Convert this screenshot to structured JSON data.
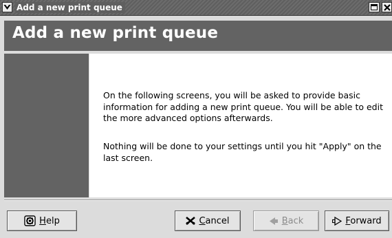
{
  "window": {
    "title": "Add a new print queue",
    "icons": {
      "menu": "chevron-down-icon",
      "maximize": "maximize-icon",
      "close": "close-icon"
    }
  },
  "header": {
    "title": "Add a new print queue"
  },
  "content": {
    "paragraph1": "On the following screens, you will be asked to provide basic information for adding a new print queue.  You will be able to edit the more advanced options afterwards.",
    "paragraph2": "Nothing will be done to your settings until you hit \"Apply\" on the last screen."
  },
  "buttons": {
    "help": {
      "mnemonic": "H",
      "rest": "elp",
      "icon": "help-icon"
    },
    "cancel": {
      "mnemonic": "C",
      "rest": "ancel",
      "icon": "cancel-icon"
    },
    "back": {
      "mnemonic": "B",
      "rest": "ack",
      "icon": "back-arrow-icon",
      "enabled": false
    },
    "forward": {
      "mnemonic": "F",
      "rest": "orward",
      "icon": "forward-arrow-icon"
    }
  },
  "colors": {
    "header_bg": "#636363",
    "content_bg": "#ffffff",
    "window_bg": "#dcdcdc"
  }
}
